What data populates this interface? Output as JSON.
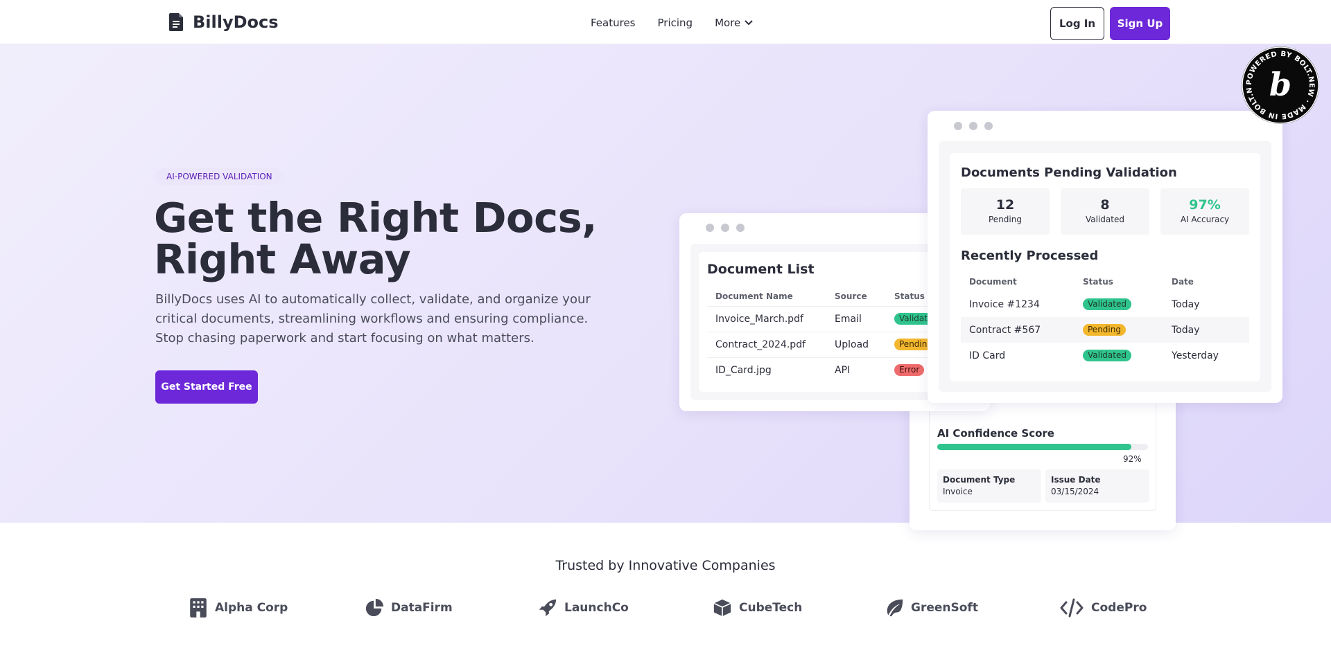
{
  "brand": {
    "name": "BillyDocs"
  },
  "nav": {
    "links": {
      "features": "Features",
      "pricing": "Pricing",
      "more": "More"
    },
    "login": "Log In",
    "signup": "Sign Up"
  },
  "hero": {
    "tag": "AI-POWERED VALIDATION",
    "headline_line1": "Get the Right Docs,",
    "headline_line2": "Right Away",
    "description": "BillyDocs uses AI to automatically collect, validate, and organize your critical documents, streamlining workflows and ensuring compliance. Stop chasing paperwork and start focusing on what matters.",
    "cta": "Get Started Free"
  },
  "confidence_card": {
    "title": "AI Confidence Score",
    "progress": 0.92,
    "progress_label": "92%",
    "meta": [
      {
        "key": "Document Type",
        "value": "Invoice"
      },
      {
        "key": "Issue Date",
        "value": "03/15/2024"
      }
    ]
  },
  "document_list": {
    "title": "Document List",
    "columns": [
      "Document Name",
      "Source",
      "Status"
    ],
    "rows": [
      {
        "name": "Invoice_March.pdf",
        "source": "Email",
        "status": "Validated"
      },
      {
        "name": "Contract_2024.pdf",
        "source": "Upload",
        "status": "Pending"
      },
      {
        "name": "ID_Card.jpg",
        "source": "API",
        "status": "Error"
      }
    ]
  },
  "pending_card": {
    "title": "Documents Pending Validation",
    "stats": [
      {
        "value": "12",
        "label": "Pending"
      },
      {
        "value": "8",
        "label": "Validated"
      },
      {
        "value": "97%",
        "label": "AI Accuracy"
      }
    ],
    "recent_title": "Recently Processed",
    "columns": [
      "Document",
      "Status",
      "Date"
    ],
    "rows": [
      {
        "doc": "Invoice #1234",
        "status": "Validated",
        "date": "Today"
      },
      {
        "doc": "Contract #567",
        "status": "Pending",
        "date": "Today"
      },
      {
        "doc": "ID Card",
        "status": "Validated",
        "date": "Yesterday"
      }
    ]
  },
  "bolt_badge": {
    "text": "POWERED BY BOLT.NEW · MADE IN BOLT.NEW ·",
    "letter": "b"
  },
  "trusted": {
    "title": "Trusted by Innovative Companies",
    "companies": [
      {
        "name": "Alpha Corp",
        "icon": "building-icon"
      },
      {
        "name": "DataFirm",
        "icon": "pie-chart-icon"
      },
      {
        "name": "LaunchCo",
        "icon": "rocket-icon"
      },
      {
        "name": "CubeTech",
        "icon": "cube-icon"
      },
      {
        "name": "GreenSoft",
        "icon": "leaf-icon"
      },
      {
        "name": "CodePro",
        "icon": "code-icon"
      }
    ]
  },
  "colors": {
    "accent": "#6d28d9",
    "success": "#2fc48d",
    "warning": "#f3b72e",
    "error": "#ef6b6b"
  }
}
